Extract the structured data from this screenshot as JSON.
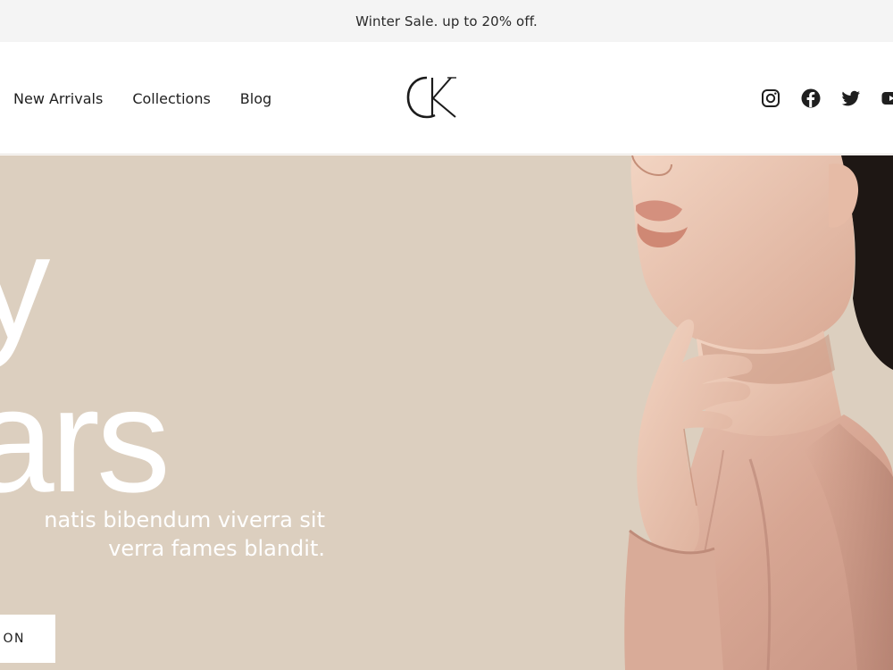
{
  "announcement": {
    "text": "Winter Sale. up to 20% off."
  },
  "nav": {
    "items": [
      {
        "label": "New Arrivals"
      },
      {
        "label": "Collections"
      },
      {
        "label": "Blog"
      }
    ]
  },
  "logo": {
    "text": "CK"
  },
  "social": {
    "icons": [
      "instagram-icon",
      "facebook-icon",
      "twitter-icon",
      "youtube-icon"
    ]
  },
  "hero": {
    "title_line1": "rty",
    "title_line2": "ears",
    "subtitle_line1": "natis bibendum viverra sit",
    "subtitle_line2": "verra fames blandit.",
    "button_label": "ON"
  },
  "colors": {
    "announcement_bg": "#f4f4f4",
    "hero_bg": "#dccfbf",
    "text_dark": "#1f1f1f"
  }
}
